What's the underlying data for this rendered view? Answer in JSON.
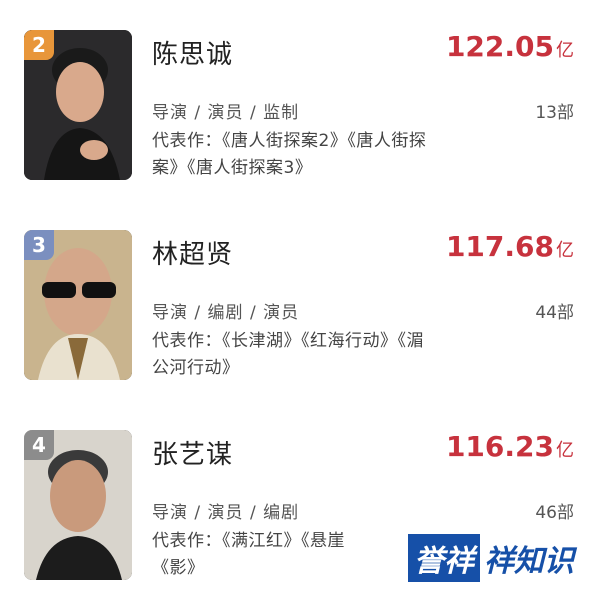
{
  "entries": [
    {
      "rank": "2",
      "rank_color": "#e8963a",
      "name": "陈思诚",
      "box_office": "122.05",
      "unit": "亿",
      "roles": "导演 / 演员 / 监制",
      "count": "13部",
      "works_line1": "代表作：《唐人街探案2》《唐人街探",
      "works_line2": "案》《唐人街探案3》"
    },
    {
      "rank": "3",
      "rank_color": "#7b8fbf",
      "name": "林超贤",
      "box_office": "117.68",
      "unit": "亿",
      "roles": "导演 / 编剧 / 演员",
      "count": "44部",
      "works_line1": "代表作：《长津湖》《红海行动》《湄",
      "works_line2": "公河行动》"
    },
    {
      "rank": "4",
      "rank_color": "#8c8c8c",
      "name": "张艺谋",
      "box_office": "116.23",
      "unit": "亿",
      "roles": "导演 / 演员 / 编剧",
      "count": "46部",
      "works_line1": "代表作：《满江红》《悬崖",
      "works_line2": "《影》"
    }
  ],
  "watermark": {
    "box_text": "誉祥",
    "text": "祥知识"
  }
}
